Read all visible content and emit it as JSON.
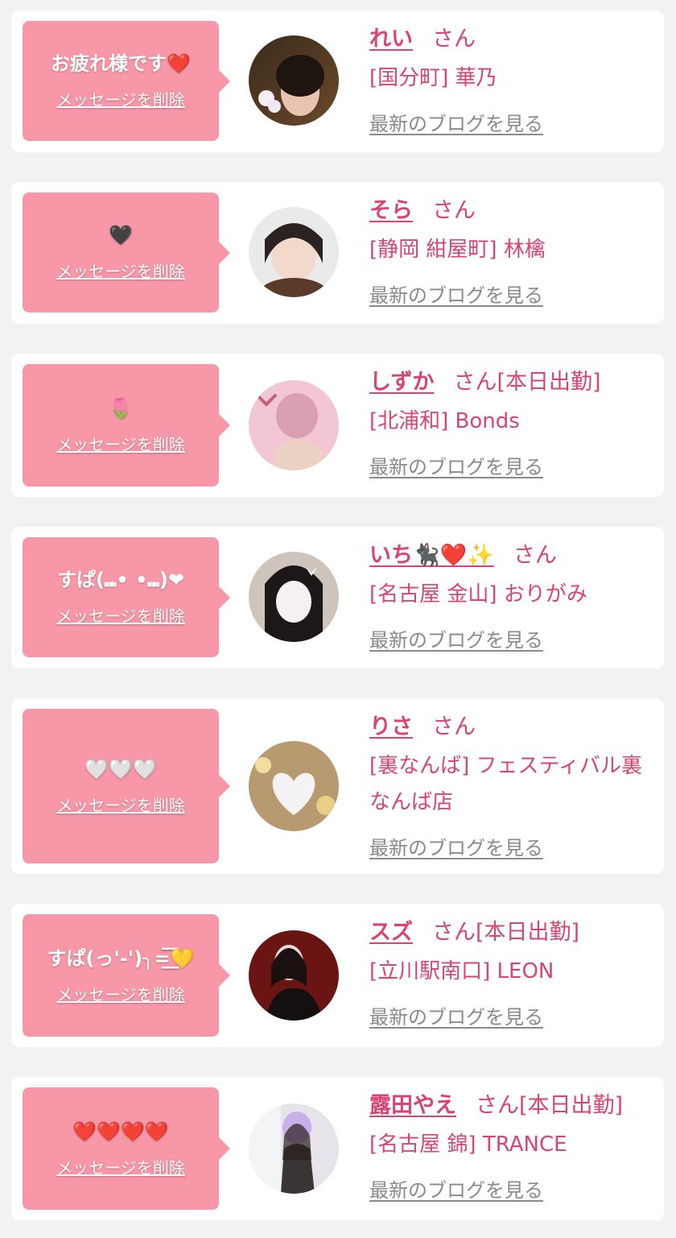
{
  "colors": {
    "bubble": "#f797a8",
    "name": "#d94470",
    "link_gray": "#8a8a8a",
    "background": "#f2f2f2"
  },
  "messages": [
    {
      "bubble_text": "お疲れ様です❤️",
      "delete_label": "メッセージを削除",
      "name": "れい",
      "honorific": "さん",
      "status": "",
      "shop": "[国分町] 華乃",
      "blog_label": "最新のブログを見る",
      "avatar": "avatar-photo"
    },
    {
      "bubble_text": "🖤",
      "delete_label": "メッセージを削除",
      "name": "そら",
      "honorific": "さん",
      "status": "",
      "shop": "[静岡 紺屋町] 林檎",
      "blog_label": "最新のブログを見る",
      "avatar": "avatar-photo"
    },
    {
      "bubble_text": "🌷",
      "delete_label": "メッセージを削除",
      "name": "しずか",
      "honorific": "さん",
      "status": "[本日出勤]",
      "shop": "[北浦和] Bonds",
      "blog_label": "最新のブログを見る",
      "avatar": "avatar-photo"
    },
    {
      "bubble_text": "すぱ(⑉• •⑉)❤",
      "delete_label": "メッセージを削除",
      "name": "いち🐈‍⬛❤️✨",
      "honorific": "さん",
      "status": "",
      "shop": "[名古屋 金山] おりがみ",
      "blog_label": "最新のブログを見る",
      "avatar": "avatar-photo"
    },
    {
      "bubble_text": "🤍🤍🤍",
      "delete_label": "メッセージを削除",
      "name": "りさ",
      "honorific": "さん",
      "status": "",
      "shop": "[裏なんば] フェスティバル裏なんば店",
      "blog_label": "最新のブログを見る",
      "avatar": "avatar-photo"
    },
    {
      "bubble_text": "すぱ(っ'-')╮=͟͟͞͞💛",
      "delete_label": "メッセージを削除",
      "name": "スズ",
      "honorific": "さん",
      "status": "[本日出勤]",
      "shop": "[立川駅南口] LEON",
      "blog_label": "最新のブログを見る",
      "avatar": "avatar-photo"
    },
    {
      "bubble_text": "❤️❤️❤️❤️",
      "delete_label": "メッセージを削除",
      "name": "露田やえ",
      "honorific": "さん",
      "status": "[本日出勤]",
      "shop": "[名古屋 錦] TRANCE",
      "blog_label": "最新のブログを見る",
      "avatar": "avatar-photo"
    }
  ]
}
